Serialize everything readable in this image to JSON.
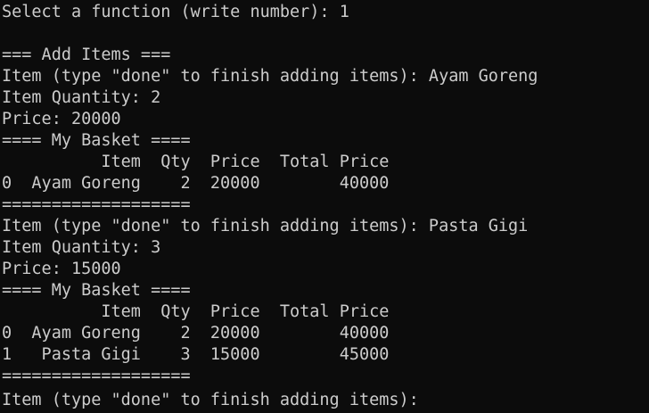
{
  "terminal": {
    "lines": [
      "Select a function (write number): 1",
      "",
      "=== Add Items ===",
      "Item (type \"done\" to finish adding items): Ayam Goreng",
      "Item Quantity: 2",
      "Price: 20000",
      "==== My Basket ====",
      "          Item  Qty  Price  Total Price",
      "0  Ayam Goreng    2  20000        40000",
      "===================",
      "Item (type \"done\" to finish adding items): Pasta Gigi",
      "Item Quantity: 3",
      "Price: 15000",
      "==== My Basket ====",
      "          Item  Qty  Price  Total Price",
      "0  Ayam Goreng    2  20000        40000",
      "1   Pasta Gigi    3  15000        45000",
      "===================",
      "Item (type \"done\" to finish adding items): "
    ]
  }
}
